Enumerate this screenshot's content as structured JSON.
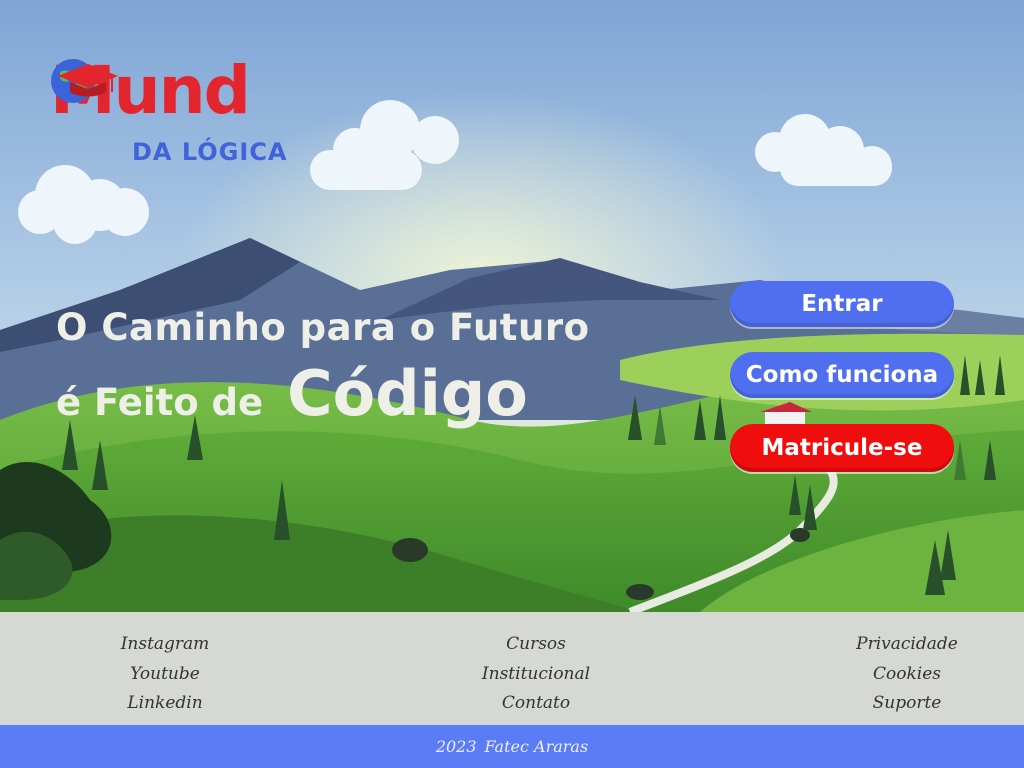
{
  "logo": {
    "word": "Mund",
    "sub": "DA LÓGICA"
  },
  "headline": {
    "line1": "O Caminho para o Futuro",
    "line2_prefix": "é Feito de",
    "line2_big": "Código"
  },
  "buttons": {
    "enter": "Entrar",
    "how": "Como funciona",
    "enroll": "Matricule-se"
  },
  "footer": {
    "social": [
      "Instagram",
      "Youtube",
      "Linkedin"
    ],
    "institutional": [
      "Cursos",
      "Institucional",
      "Contato"
    ],
    "legal": [
      "Privacidade",
      "Cookies",
      "Suporte"
    ]
  },
  "copyright": {
    "year": "2023",
    "org": "Fatec Araras"
  },
  "colors": {
    "accent_blue": "#4f6ff0",
    "accent_red": "#f00d0d",
    "footer_bg": "#d6d8d4",
    "copyright_bg": "#5a7cf4"
  }
}
